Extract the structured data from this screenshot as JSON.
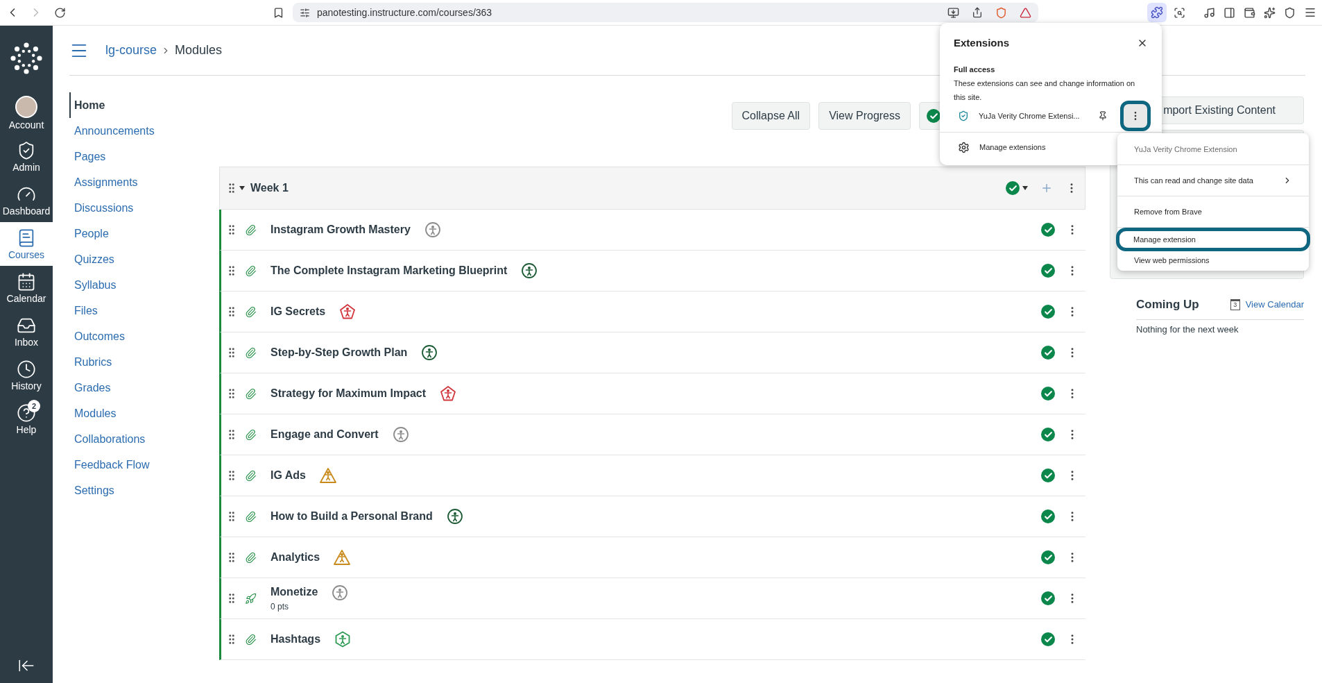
{
  "browser": {
    "url": "panotesting.instructure.com/courses/363",
    "extensions_open": true
  },
  "global_nav": [
    {
      "label": "Account",
      "kind": "avatar",
      "selected": false
    },
    {
      "label": "Admin",
      "kind": "shield",
      "selected": false
    },
    {
      "label": "Dashboard",
      "kind": "gauge",
      "selected": false
    },
    {
      "label": "Courses",
      "kind": "book",
      "selected": true
    },
    {
      "label": "Calendar",
      "kind": "calendar",
      "selected": false
    },
    {
      "label": "Inbox",
      "kind": "inbox",
      "selected": false
    },
    {
      "label": "History",
      "kind": "clock",
      "selected": false
    },
    {
      "label": "Help",
      "kind": "help",
      "selected": false,
      "badge": "2"
    }
  ],
  "breadcrumb": [
    "lg-course",
    "Modules"
  ],
  "course_nav": [
    {
      "label": "Home",
      "selected": true
    },
    {
      "label": "Announcements",
      "selected": false
    },
    {
      "label": "Pages",
      "selected": false
    },
    {
      "label": "Assignments",
      "selected": false
    },
    {
      "label": "Discussions",
      "selected": false
    },
    {
      "label": "People",
      "selected": false
    },
    {
      "label": "Quizzes",
      "selected": false
    },
    {
      "label": "Syllabus",
      "selected": false
    },
    {
      "label": "Files",
      "selected": false
    },
    {
      "label": "Outcomes",
      "selected": false
    },
    {
      "label": "Rubrics",
      "selected": false
    },
    {
      "label": "Grades",
      "selected": false
    },
    {
      "label": "Modules",
      "selected": false
    },
    {
      "label": "Collaborations",
      "selected": false
    },
    {
      "label": "Feedback Flow",
      "selected": false
    },
    {
      "label": "Settings",
      "selected": false
    }
  ],
  "toolbar": {
    "buttons": [
      "Collapse All",
      "View Progress"
    ],
    "publish_published": true
  },
  "module": {
    "title": "Week 1",
    "published": true,
    "items": [
      {
        "title": "Instagram Growth Mastery",
        "kind": "attachment",
        "published": true,
        "accessibility": {
          "kind": "circle",
          "color": "#8c8c8c"
        }
      },
      {
        "title": "The Complete Instagram Marketing Blueprint",
        "kind": "attachment",
        "published": true,
        "accessibility": {
          "kind": "circle",
          "color": "#1d5c35"
        }
      },
      {
        "title": "IG Secrets",
        "kind": "attachment",
        "published": true,
        "accessibility": {
          "kind": "pentagon",
          "color": "#d1343b"
        }
      },
      {
        "title": "Step-by-Step Growth Plan",
        "kind": "attachment",
        "published": true,
        "accessibility": {
          "kind": "circle",
          "color": "#1d5c35"
        }
      },
      {
        "title": "Strategy for Maximum Impact",
        "kind": "attachment",
        "published": true,
        "accessibility": {
          "kind": "pentagon",
          "color": "#d1343b"
        }
      },
      {
        "title": "Engage and Convert",
        "kind": "attachment",
        "published": true,
        "accessibility": {
          "kind": "circle",
          "color": "#8c8c8c"
        }
      },
      {
        "title": "IG Ads",
        "kind": "attachment",
        "published": true,
        "accessibility": {
          "kind": "triangle",
          "color": "#c98a1c"
        }
      },
      {
        "title": "How to Build a Personal Brand",
        "kind": "attachment",
        "published": true,
        "accessibility": {
          "kind": "circle",
          "color": "#1d5c35"
        }
      },
      {
        "title": "Analytics",
        "kind": "attachment",
        "published": true,
        "accessibility": {
          "kind": "triangle",
          "color": "#c98a1c"
        }
      },
      {
        "title": "Monetize",
        "kind": "quiz",
        "points": "0 pts",
        "published": true,
        "accessibility": {
          "kind": "circle",
          "color": "#8c8c8c"
        }
      },
      {
        "title": "Hashtags",
        "kind": "attachment",
        "published": true,
        "accessibility": {
          "kind": "hexagon",
          "color": "#2e9a54"
        }
      }
    ]
  },
  "sidebar": {
    "import_button": "mport Existing Content",
    "coming_up": {
      "title": "Coming Up",
      "link": "View Calendar",
      "calendar_day": "3",
      "empty": "Nothing for the next week"
    }
  },
  "extensions_popup": {
    "title": "Extensions",
    "section_title": "Full access",
    "description": "These extensions can see and change information on this site.",
    "extension_name": "YuJa Verity Chrome Extensi...",
    "menu_highlighted": true,
    "manage": "Manage extensions"
  },
  "context_menu": {
    "items": [
      {
        "label": "YuJa Verity Chrome Extension",
        "kind": "header",
        "highlighted": false
      },
      {
        "label": "This can read and change site data",
        "kind": "submenu",
        "highlighted": false
      },
      {
        "label": "Remove from Brave",
        "kind": "item",
        "highlighted": false
      },
      {
        "label": "Manage extension",
        "kind": "item",
        "highlighted": true
      },
      {
        "label": "View web permissions",
        "kind": "item",
        "highlighted": false
      }
    ]
  }
}
